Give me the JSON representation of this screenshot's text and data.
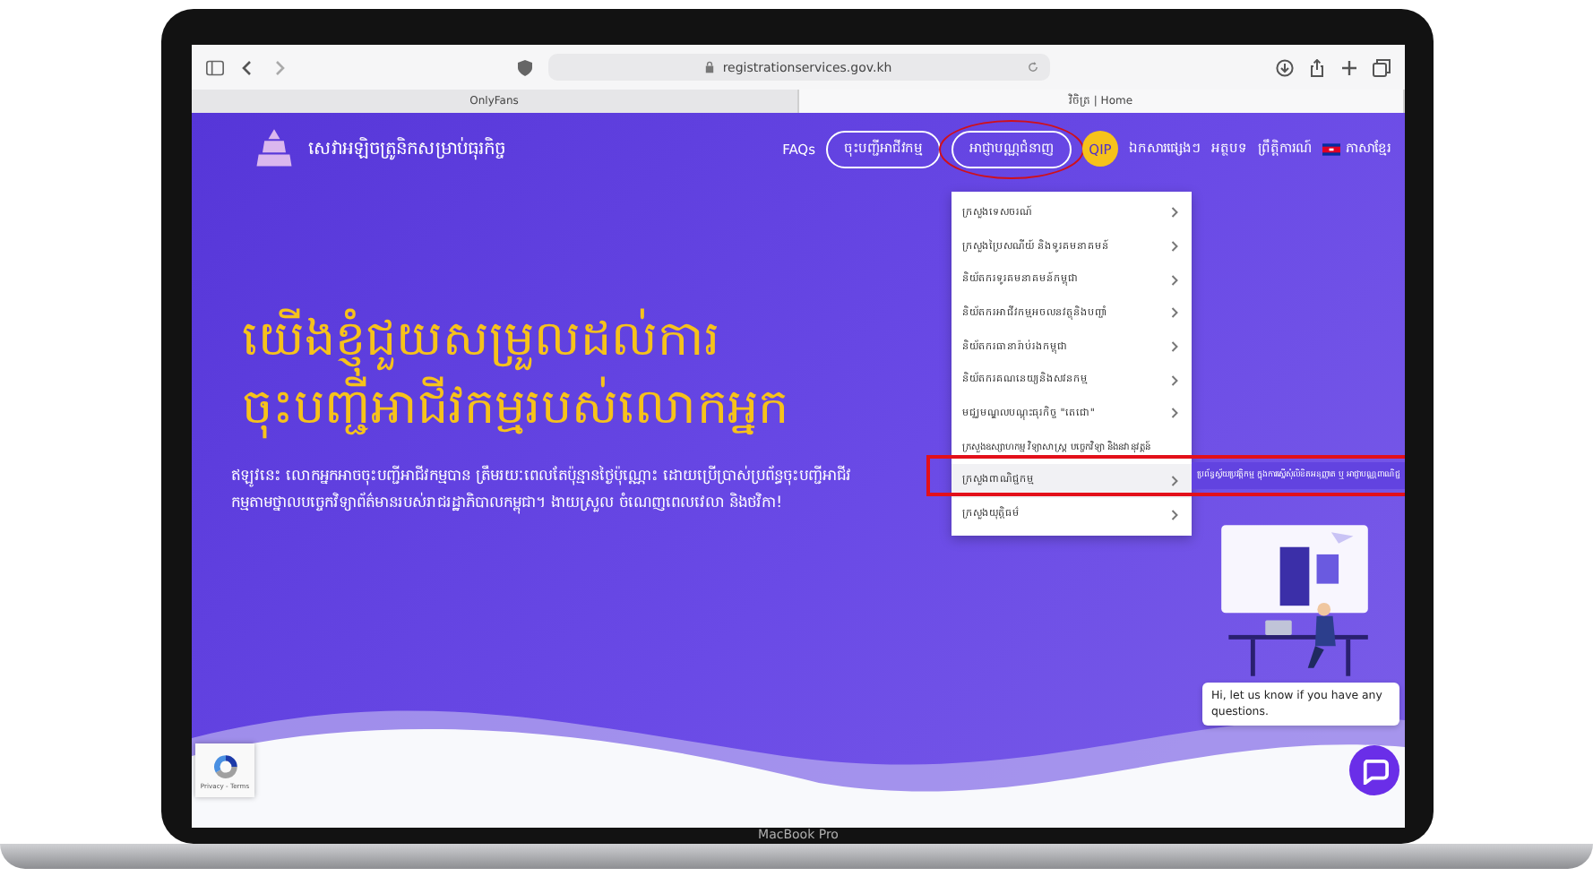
{
  "browser": {
    "url": "registrationservices.gov.kh",
    "tabs": [
      {
        "label": "OnlyFans",
        "selected": false
      },
      {
        "label": "វិចិត្រ | Home",
        "selected": true
      }
    ]
  },
  "site": {
    "logo_text": "សេវាអឡិចត្រូនិកសម្រាប់ធុរកិច្ច",
    "nav": [
      {
        "label": "FAQs",
        "kind": "link",
        "annotated": false
      },
      {
        "label": "ចុះបញ្ជីអាជីវកម្ម",
        "kind": "outline",
        "annotated": false
      },
      {
        "label": "អាជ្ញាបណ្ណជំនាញ",
        "kind": "outline",
        "annotated": true
      },
      {
        "label": "QIP",
        "kind": "pill",
        "annotated": false
      },
      {
        "label": "ឯកសារផ្សេងៗ",
        "kind": "link",
        "annotated": false
      },
      {
        "label": "អត្ថបទ",
        "kind": "link",
        "annotated": false
      },
      {
        "label": "ព្រឹត្តិការណ៍",
        "kind": "link",
        "annotated": false
      },
      {
        "label": "ភាសាខ្មែរ",
        "kind": "language",
        "annotated": false
      }
    ]
  },
  "dropdown": {
    "items": [
      {
        "label": "ក្រសួងទេសចរណ៍",
        "has_submenu": true,
        "selected": false
      },
      {
        "label": "ក្រសួងប្រៃសណីយ៍ និងទូរគមនាគមន៍",
        "has_submenu": true,
        "selected": false
      },
      {
        "label": "និយ័តករទូរគមនាគមន៍កម្ពុជា",
        "has_submenu": true,
        "selected": false
      },
      {
        "label": "និយ័តករអាជីវកម្មអចលនវត្ថុនិងបញ្ចាំ",
        "has_submenu": true,
        "selected": false
      },
      {
        "label": "និយ័តករធានារ៉ាប់រងកម្ពុជា",
        "has_submenu": true,
        "selected": false
      },
      {
        "label": "និយ័តករគណនេយ្យនិងសវនកម្ម",
        "has_submenu": true,
        "selected": false
      },
      {
        "label": "មជ្ឈមណ្ឌលបណ្តុះធុរកិច្ច \"តេជោ\"",
        "has_submenu": true,
        "selected": false
      },
      {
        "label": "ក្រសួងឧស្សាហកម្ម វិទ្យាសាស្ត្រ បច្ចេកវិទ្យា និងនវានុវត្តន៍",
        "has_submenu": false,
        "selected": false
      },
      {
        "label": "ក្រសួងពាណិជ្ជកម្ម",
        "has_submenu": true,
        "selected": true,
        "submenu": "ប្រព័ន្ធស្វ័យប្រវត្តិកម្ម ក្នុងការស្នើសុំលិខិតអនុញ្ញាត ឬ អាជ្ញាបណ្ណពាណិជ្ជ"
      },
      {
        "label": "ក្រសួងយុត្តិធម៌",
        "has_submenu": true,
        "selected": false
      }
    ]
  },
  "hero": {
    "title_lines": [
      "យើងខ្ញុំជួយសម្រួលដល់ការ",
      "ចុះបញ្ជីអាជីវកម្មរបស់លោកអ្នក"
    ],
    "paragraph": "ឥឡូវនេះ លោកអ្នកអាចចុះបញ្ជីអាជីវកម្មបាន ត្រឹមរយៈពេលតែប៉ុន្មានថ្ងៃប៉ុណ្ណោះ ដោយប្រើប្រាស់ប្រព័ន្ធចុះបញ្ជីអាជីវកម្មតាមថ្នាលបច្ចេកវិទ្យាព័ត៌មានរបស់រាជរដ្ឋាភិបាលកម្ពុជា។ ងាយស្រួល ចំណេញពេលវេលា និងថវិកា!"
  },
  "chat": {
    "message": "Hi, let us know if you have any questions."
  },
  "recaptcha": {
    "label": "Privacy - Terms"
  },
  "laptop": {
    "label": "MacBook Pro"
  }
}
